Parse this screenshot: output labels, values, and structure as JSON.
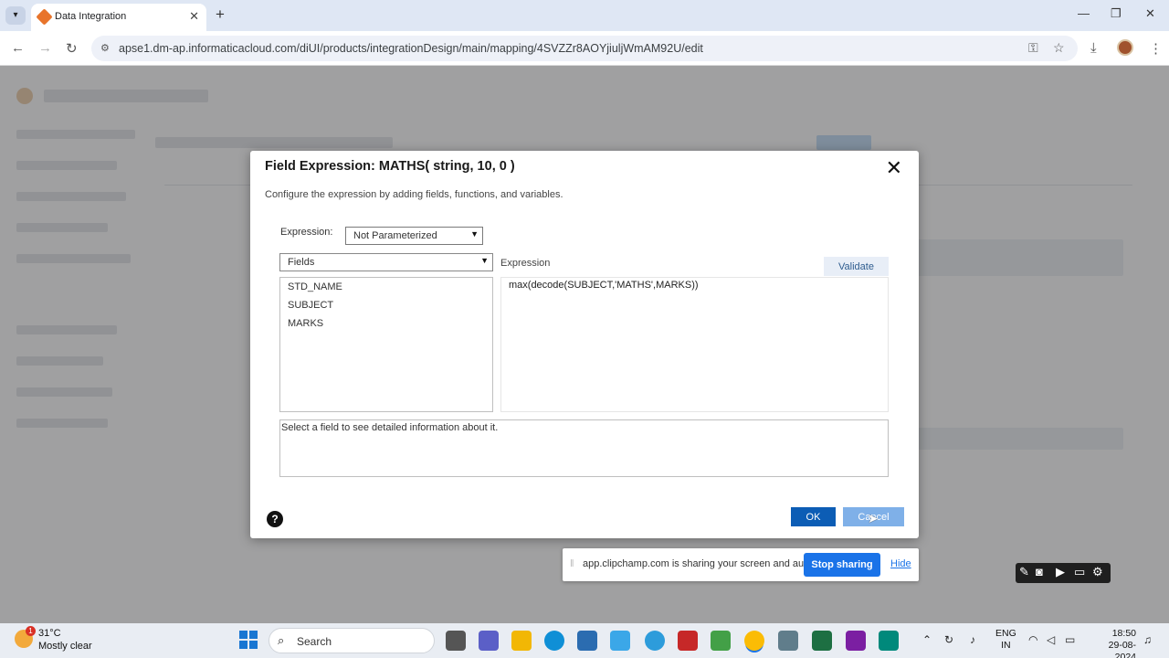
{
  "browser": {
    "tab_title": "Data Integration",
    "url": "apse1.dm-ap.informaticacloud.com/diUI/products/integrationDesign/main/mapping/4SVZZr8AOYjiuljWmAM92U/edit"
  },
  "modal": {
    "title": "Field Expression: MATHS( string, 10, 0 )",
    "subtitle": "Configure the expression by adding fields, functions, and variables.",
    "expression_label": "Expression:",
    "parameter_select": "Not Parameterized",
    "fields_select": "Fields",
    "expression_header": "Expression",
    "validate_label": "Validate",
    "fields": [
      "STD_NAME",
      "SUBJECT",
      "MARKS"
    ],
    "expression_text": "max(decode(SUBJECT,'MATHS',MARKS))",
    "info_text": "Select a field to see detailed information about it.",
    "ok_label": "OK",
    "cancel_label": "Cancel",
    "help_glyph": "?"
  },
  "share_bar": {
    "message": "app.clipchamp.com is sharing your screen and audio.",
    "stop_label": "Stop sharing",
    "hide_label": "Hide"
  },
  "taskbar": {
    "temperature": "31°C",
    "condition": "Mostly clear",
    "weather_badge": "1",
    "search_placeholder": "Search",
    "language_line1": "ENG",
    "language_line2": "IN",
    "time": "18:50",
    "date": "29-08-2024"
  },
  "colors": {
    "primary_button": "#0c5db5",
    "share_button": "#1a73e8",
    "overlay": "rgba(40,40,40,0.42)"
  }
}
